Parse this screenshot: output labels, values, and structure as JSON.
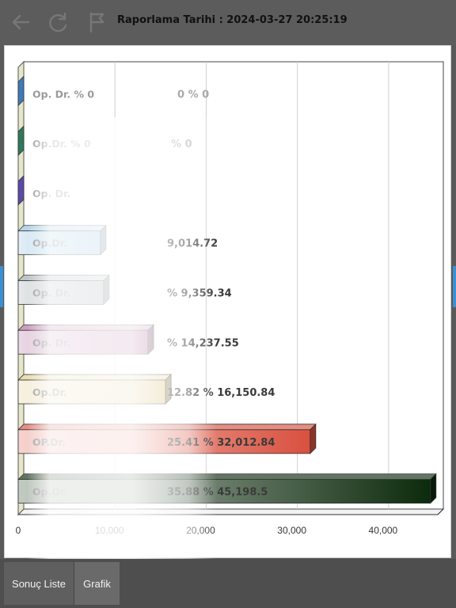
{
  "header": {
    "report_date_label": "Raporlama Tarihi : 2024-03-27 20:25:19"
  },
  "toolbar": {
    "icons": [
      "back-arrow-icon",
      "refresh-icon",
      "flag-icon"
    ]
  },
  "tabs": [
    {
      "label": "Sonuç Liste"
    },
    {
      "label": "Grafik"
    }
  ],
  "chart_data": {
    "type": "bar",
    "orientation": "horizontal",
    "style": "3d",
    "grid": true,
    "xlim": [
      0,
      46000
    ],
    "x_ticks": [
      "0",
      "10,000",
      "20,000",
      "30,000",
      "40,000"
    ],
    "x_tick_values": [
      0,
      10000,
      20000,
      30000,
      40000
    ],
    "series": [
      {
        "label": "Op. Dr.  % 0",
        "value_label": "0 % 0",
        "value": 0,
        "color": "#3e7bb6"
      },
      {
        "label": "Op.Dr.  % 0",
        "value_label": "% 0",
        "value": 0,
        "color": "#2f7a5a"
      },
      {
        "label": "Op. Dr.",
        "value_label": "",
        "value": 0,
        "color": "#5b4aa8"
      },
      {
        "label": "Op.Dr.",
        "value_label": "9,014.72",
        "value": 9014.72,
        "color": "#8fc0dd"
      },
      {
        "label": "Op. Dr.",
        "value_label": "% 9,359.34",
        "value": 9359.34,
        "color": "#9aa6ab"
      },
      {
        "label": "Op. Dr.",
        "value_label": "% 14,237.55",
        "value": 14237.55,
        "color": "#b06a9a"
      },
      {
        "label": "Op.Dr.",
        "value_label": "12.82 % 16,150.84",
        "value": 16150.84,
        "color": "#e0c98a"
      },
      {
        "label": "OP.Dr.",
        "value_label": "25.41 % 32,012.84",
        "value": 32012.84,
        "color": "#d9503e"
      },
      {
        "label": "Op.Dr.",
        "value_label": "35.88 % 45,198.5",
        "value": 45198.5,
        "color": "#0c2a0c"
      }
    ]
  }
}
